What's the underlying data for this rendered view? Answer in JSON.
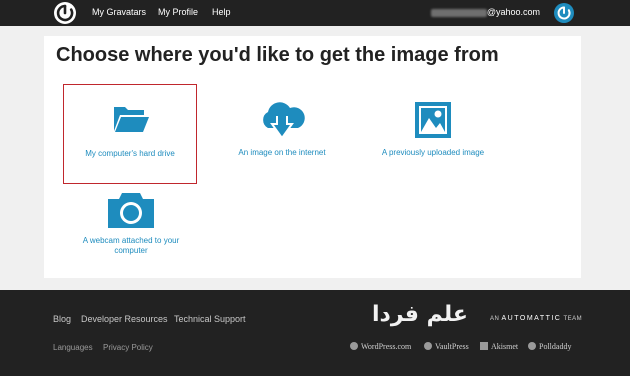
{
  "header": {
    "logo_icon": "gravatar-logo-icon",
    "nav": [
      "My Gravatars",
      "My Profile",
      "Help"
    ],
    "email_visible": "@yahoo.com",
    "avatar_icon": "gravatar-avatar-icon"
  },
  "main": {
    "title": "Choose where you'd like to get the image from",
    "options": [
      {
        "label": "My computer's hard drive",
        "icon": "folder-icon",
        "selected": true
      },
      {
        "label": "An image on the internet",
        "icon": "cloud-download-icon",
        "selected": false
      },
      {
        "label": "A previously uploaded image",
        "icon": "image-icon",
        "selected": false
      },
      {
        "label": "A webcam attached to your computer",
        "icon": "camera-icon",
        "selected": false
      }
    ]
  },
  "footer": {
    "links": [
      "Blog",
      "Developer Resources",
      "Technical Support"
    ],
    "secondary_links": [
      "Languages",
      "Privacy Policy"
    ],
    "watermark": "علم فردا",
    "automattic_prefix": "AN",
    "automattic_name": "AUTOMATTIC",
    "automattic_suffix": "TEAM",
    "brands": [
      "WordPress.com",
      "VaultPress",
      "Akismet",
      "Polldaddy"
    ]
  },
  "colors": {
    "accent": "#1e8cbe",
    "dark": "#222222",
    "selection_border": "#c0272d"
  }
}
